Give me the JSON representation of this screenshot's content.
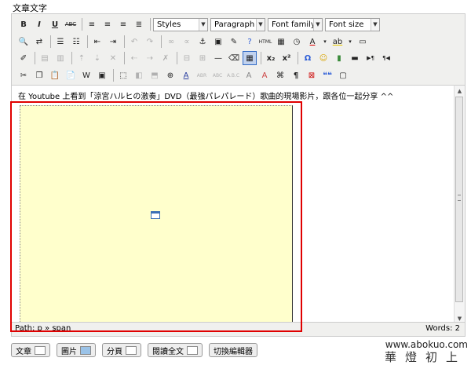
{
  "section_label": "文章文字",
  "toolbar": {
    "row1": {
      "bold": "B",
      "italic": "I",
      "underline": "U",
      "strike": "ABC",
      "styles": "Styles",
      "format": "Paragraph",
      "font_family": "Font family",
      "font_size": "Font size"
    },
    "row2": {
      "undo": "↶",
      "redo": "↷",
      "help": "?",
      "html": "HTML",
      "forecolor": "A",
      "backcolor": "ab"
    },
    "row3": {
      "hr": "—",
      "sub": "x₂",
      "sup": "x²",
      "omega": "Ω",
      "smiley": "☺",
      "ltr": "▶¶",
      "rtl": "¶◀"
    },
    "row4": {
      "styleprops": "A",
      "cite": "❝❝",
      "pilcrow": "¶"
    }
  },
  "content": {
    "text": "在 Youtube 上看到「涼宮ハルヒの激奏」DVD（最強パレパレード）歌曲的現場影片，跟各位一起分享 ^^"
  },
  "status": {
    "path": "Path: p » span",
    "words": "Words: 2"
  },
  "buttons": [
    {
      "label": "文章"
    },
    {
      "label": "圖片"
    },
    {
      "label": "分頁"
    },
    {
      "label": "閱讀全文"
    },
    {
      "label": "切換編輯器"
    }
  ],
  "watermark": {
    "url": "www.abokuo.com",
    "name": "華燈初上"
  },
  "colors": {
    "video_placeholder_bg": "#ffffcc",
    "highlight_border": "#e00000",
    "editor_bg": "#f0f0ee"
  }
}
